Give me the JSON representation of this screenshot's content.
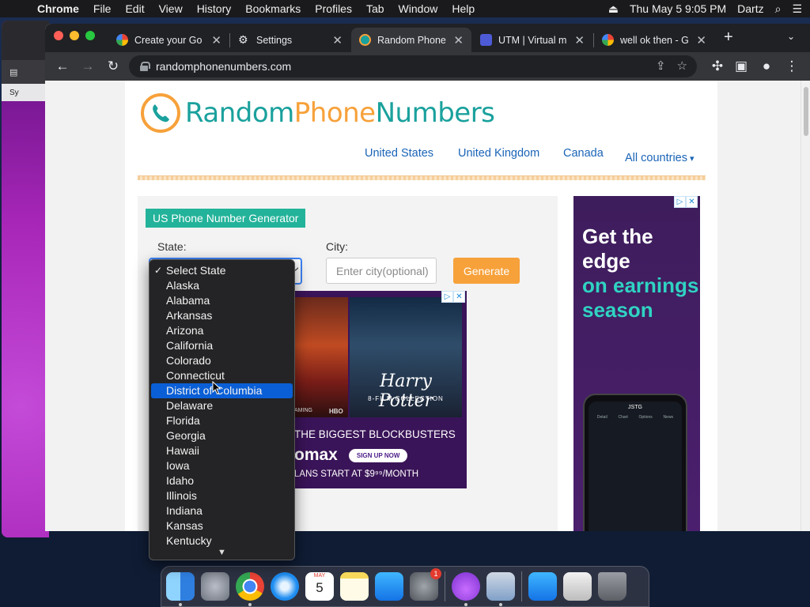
{
  "menubar": {
    "app": "Chrome",
    "items": [
      "File",
      "Edit",
      "View",
      "History",
      "Bookmarks",
      "Profiles",
      "Tab",
      "Window",
      "Help"
    ],
    "datetime": "Thu May 5  9:05 PM",
    "user": "Dartz"
  },
  "background_window": {
    "label": "Sy"
  },
  "browser": {
    "tabs": [
      {
        "title": "Create your Go",
        "favicon": "google-icon"
      },
      {
        "title": "Settings",
        "favicon": "gear-icon"
      },
      {
        "title": "Random Phone",
        "favicon": "phone-icon"
      },
      {
        "title": "UTM | Virtual m",
        "favicon": "utm-icon"
      },
      {
        "title": "well ok then - G",
        "favicon": "google-icon"
      }
    ],
    "active_tab": 2,
    "url": "randomphonenumbers.com"
  },
  "site": {
    "logo_parts": [
      "Random",
      "Phone",
      "Numbers"
    ],
    "nav": [
      "United States",
      "United Kingdom",
      "Canada",
      "All countries"
    ]
  },
  "generator": {
    "badge": "US Phone Number Generator",
    "state_label": "State:",
    "city_label": "City:",
    "city_placeholder": "Enter city(optional)",
    "generate_label": "Generate"
  },
  "dropdown": {
    "checked_index": 0,
    "highlighted_index": 8,
    "options": [
      "Select State",
      "Alaska",
      "Alabama",
      "Arkansas",
      "Arizona",
      "California",
      "Colorado",
      "Connecticut",
      "District of Columbia",
      "Delaware",
      "Florida",
      "Georgia",
      "Hawaii",
      "Iowa",
      "Idaho",
      "Illinois",
      "Indiana",
      "Kansas",
      "Kentucky"
    ]
  },
  "ad_hbo": {
    "movie_title": "Harry Potter",
    "movie_subtitle": "8-FILM COLLECTION",
    "studio": "HBO",
    "gaming": "AMING",
    "headline": "THE BIGGEST BLOCKBUSTERS",
    "brand": "omax",
    "signup": "SIGN UP NOW",
    "plans": "LANS START AT $9⁹⁹/MONTH"
  },
  "ad_right": {
    "line1": "Get the edge",
    "line2": "on earnings season",
    "phone_ticker": "JSTG",
    "phone_tabs": [
      "Detail",
      "Chart",
      "Options",
      "News"
    ]
  },
  "dock": {
    "calendar_month": "MAY",
    "calendar_day": "5",
    "notification_count": "1"
  },
  "colors": {
    "accent_teal": "#1aa19d",
    "accent_orange": "#f7a13a",
    "link_blue": "#1a64b7",
    "highlight_blue": "#0a5fd6"
  }
}
